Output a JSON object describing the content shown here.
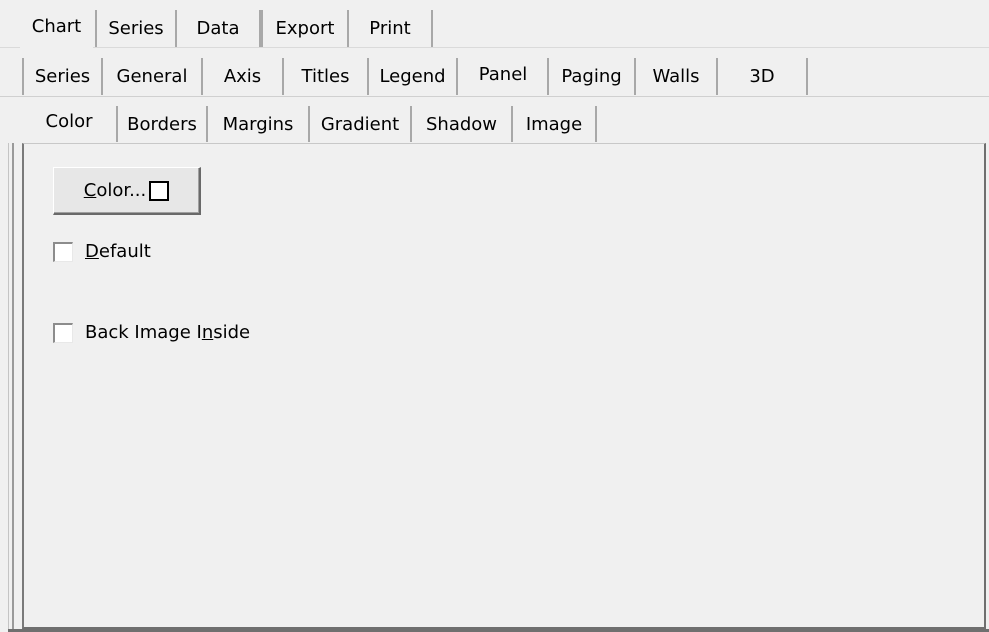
{
  "tabs_level1": [
    {
      "label": "Chart",
      "active": true
    },
    {
      "label": "Series",
      "active": false
    },
    {
      "label": "Data",
      "active": false
    },
    {
      "label": "Export",
      "active": false
    },
    {
      "label": "Print",
      "active": false
    }
  ],
  "tabs_level2": [
    {
      "label": "Series",
      "active": false
    },
    {
      "label": "General",
      "active": false
    },
    {
      "label": "Axis",
      "active": false
    },
    {
      "label": "Titles",
      "active": false
    },
    {
      "label": "Legend",
      "active": false
    },
    {
      "label": "Panel",
      "active": true
    },
    {
      "label": "Paging",
      "active": false
    },
    {
      "label": "Walls",
      "active": false
    },
    {
      "label": "3D",
      "active": false
    }
  ],
  "tabs_level3": [
    {
      "label": "Color",
      "active": true
    },
    {
      "label": "Borders",
      "active": false
    },
    {
      "label": "Margins",
      "active": false
    },
    {
      "label": "Gradient",
      "active": false
    },
    {
      "label": "Shadow",
      "active": false
    },
    {
      "label": "Image",
      "active": false
    }
  ],
  "color_button": {
    "label_accel": "C",
    "label_rest": "olor...",
    "swatch_color": "#ffffff"
  },
  "default_checkbox": {
    "label_accel": "D",
    "label_rest": "efault",
    "checked": false
  },
  "back_image_checkbox": {
    "label_before": "Back Image I",
    "label_accel": "n",
    "label_after": "side",
    "checked": false
  },
  "colors": {
    "face": "#f0f0f0",
    "border_dark": "#6f6f6f",
    "swatch_border": "#000000"
  }
}
